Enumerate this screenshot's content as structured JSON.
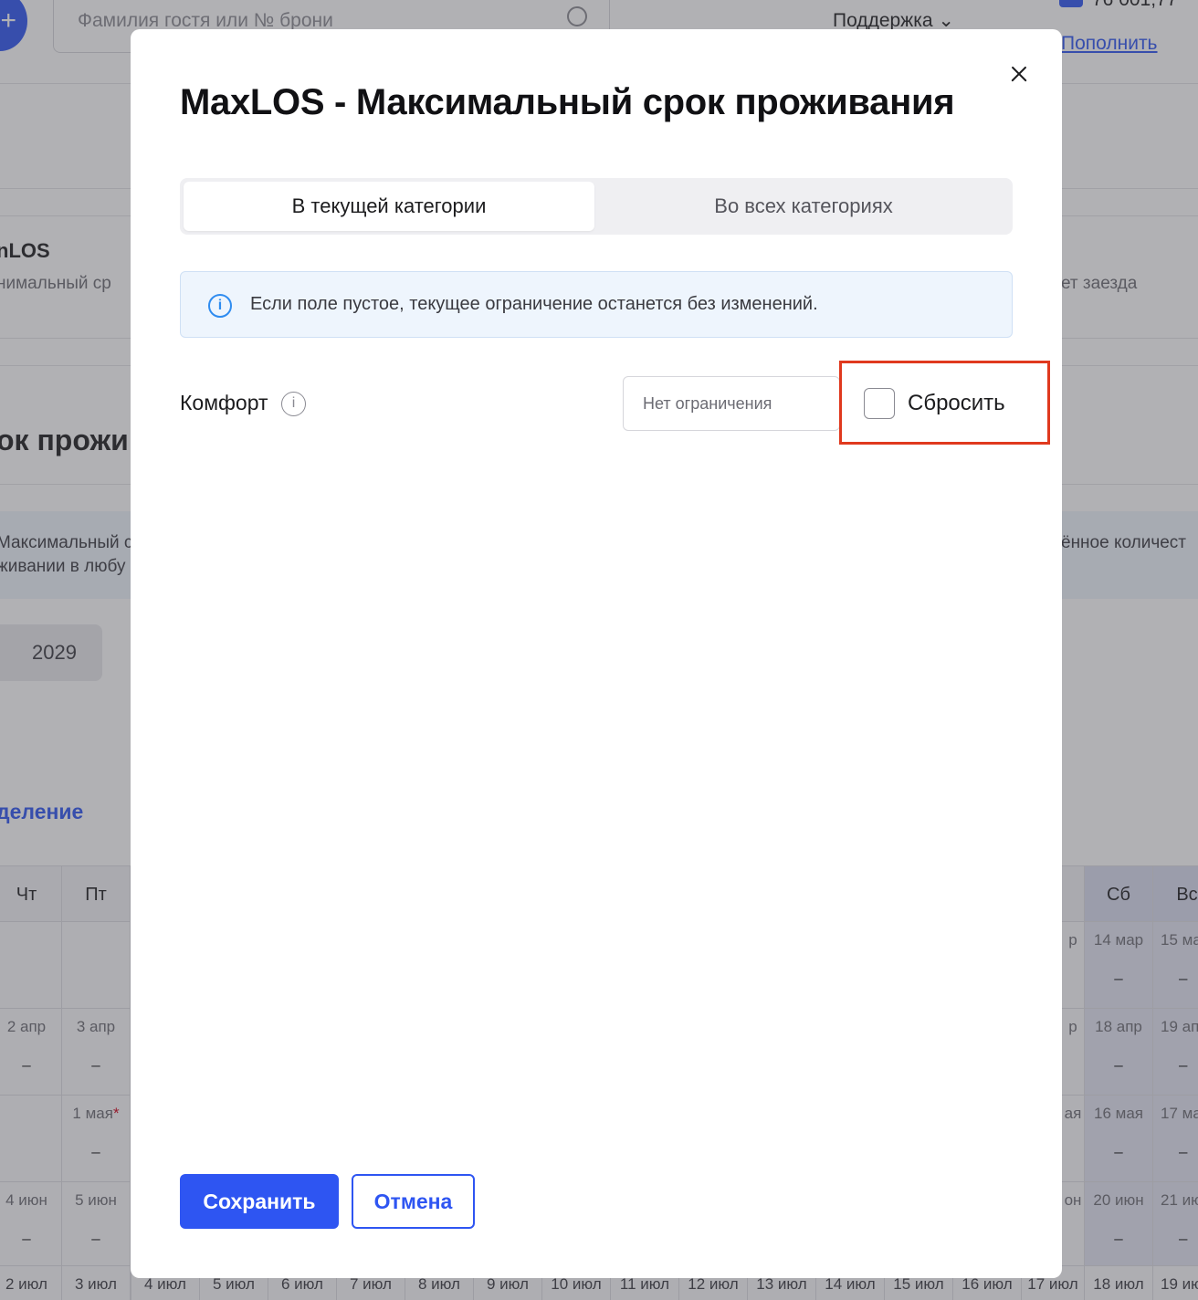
{
  "background": {
    "header": {
      "search_placeholder": "Фамилия гостя или № брони",
      "support_label": "Поддержка",
      "balance": "76 001,77",
      "topup_label": "Пополнить"
    },
    "minlos_title": "nLOS",
    "minlos_subtitle": "нимальный ср",
    "right_subtitle": "ет заезда",
    "section_title": "ок прожив",
    "info_line1": "Максимальный с",
    "info_line2": "живании в любу",
    "info_right": "ённое количест",
    "year": "2029",
    "link": "деление",
    "calendar": {
      "headers": [
        {
          "label": "Чт",
          "weekend": false
        },
        {
          "label": "Пт",
          "weekend": false
        },
        {
          "label": "Сб",
          "weekend": true
        },
        {
          "label": "Вс",
          "weekend": true
        }
      ],
      "rows": [
        {
          "left": [
            "",
            ""
          ],
          "right": [
            "14 мар",
            "15 ма"
          ],
          "right_edge": "р"
        },
        {
          "left": [
            "2 апр",
            "3 апр"
          ],
          "right": [
            "18 апр",
            "19 ап"
          ],
          "right_edge": "р"
        },
        {
          "left": [
            "",
            "1 мая"
          ],
          "right": [
            "16 мая",
            "17 ма"
          ],
          "right_edge": "ая"
        },
        {
          "left": [
            "4 июн",
            "5 июн"
          ],
          "right": [
            "20 июн",
            "21 ию"
          ],
          "right_edge": "он"
        }
      ],
      "dash": "–",
      "bottom_row": [
        "2 июл",
        "3 июл",
        "4 июл",
        "5 июл",
        "6 июл",
        "7 июл",
        "8 июл",
        "9 июл",
        "10 июл",
        "11 июл",
        "12 июл",
        "13 июл",
        "14 июл",
        "15 июл",
        "16 июл",
        "17 июл",
        "18 июл",
        "19 ию"
      ]
    }
  },
  "modal": {
    "title": "MaxLOS - Максимальный срок проживания",
    "tabs": [
      {
        "label": "В текущей категории",
        "active": true
      },
      {
        "label": "Во всех категориях",
        "active": false
      }
    ],
    "notice": {
      "icon": "info-icon",
      "text": "Если поле пустое, текущее ограничение останется без изменений."
    },
    "row": {
      "label": "Комфорт",
      "input_value": "",
      "input_placeholder": "Нет ограничения",
      "reset_label": "Сбросить",
      "reset_checked": false
    },
    "save_label": "Сохранить",
    "cancel_label": "Отмена"
  },
  "colors": {
    "accent": "#2e55f2",
    "highlight": "#e0391e",
    "info": "#2f8cf0"
  }
}
